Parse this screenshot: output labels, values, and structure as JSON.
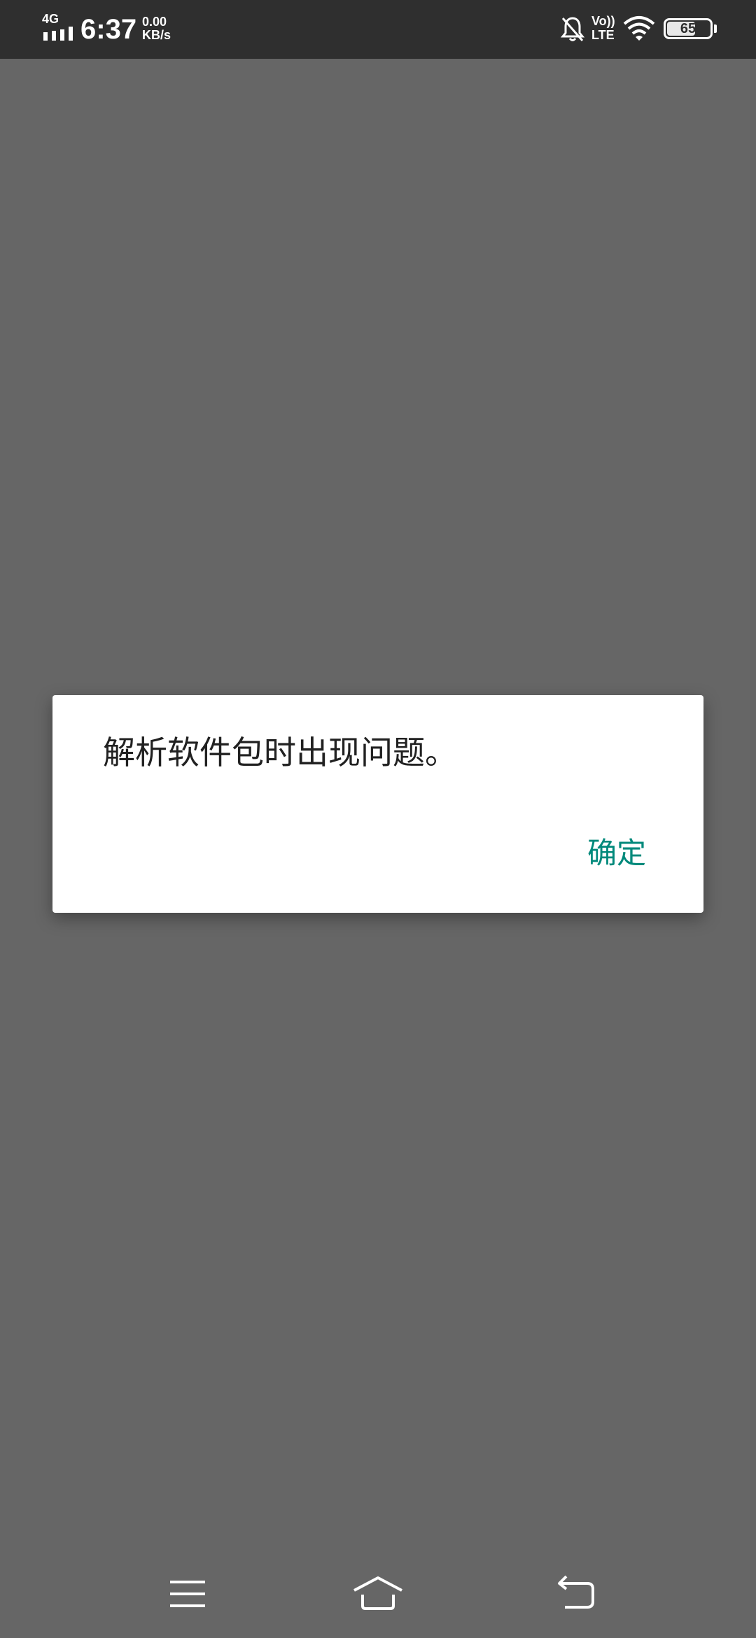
{
  "status_bar": {
    "network_type": "4G",
    "time": "6:37",
    "speed_value": "0.00",
    "speed_unit": "KB/s",
    "volte_top": "Vo))",
    "volte_bottom": "LTE",
    "battery_level": "65",
    "icons": [
      "signal-icon",
      "bell-muted-icon",
      "volte-icon",
      "wifi-icon",
      "battery-icon"
    ]
  },
  "dialog": {
    "message": "解析软件包时出现问题。",
    "ok_label": "确定",
    "accent_color": "#00897b"
  },
  "nav_bar": {
    "icons": [
      "menu-icon",
      "home-icon",
      "back-icon"
    ]
  },
  "colors": {
    "scrim": "#666666",
    "status_bar": "#2f2f2f",
    "dialog_bg": "#ffffff"
  }
}
